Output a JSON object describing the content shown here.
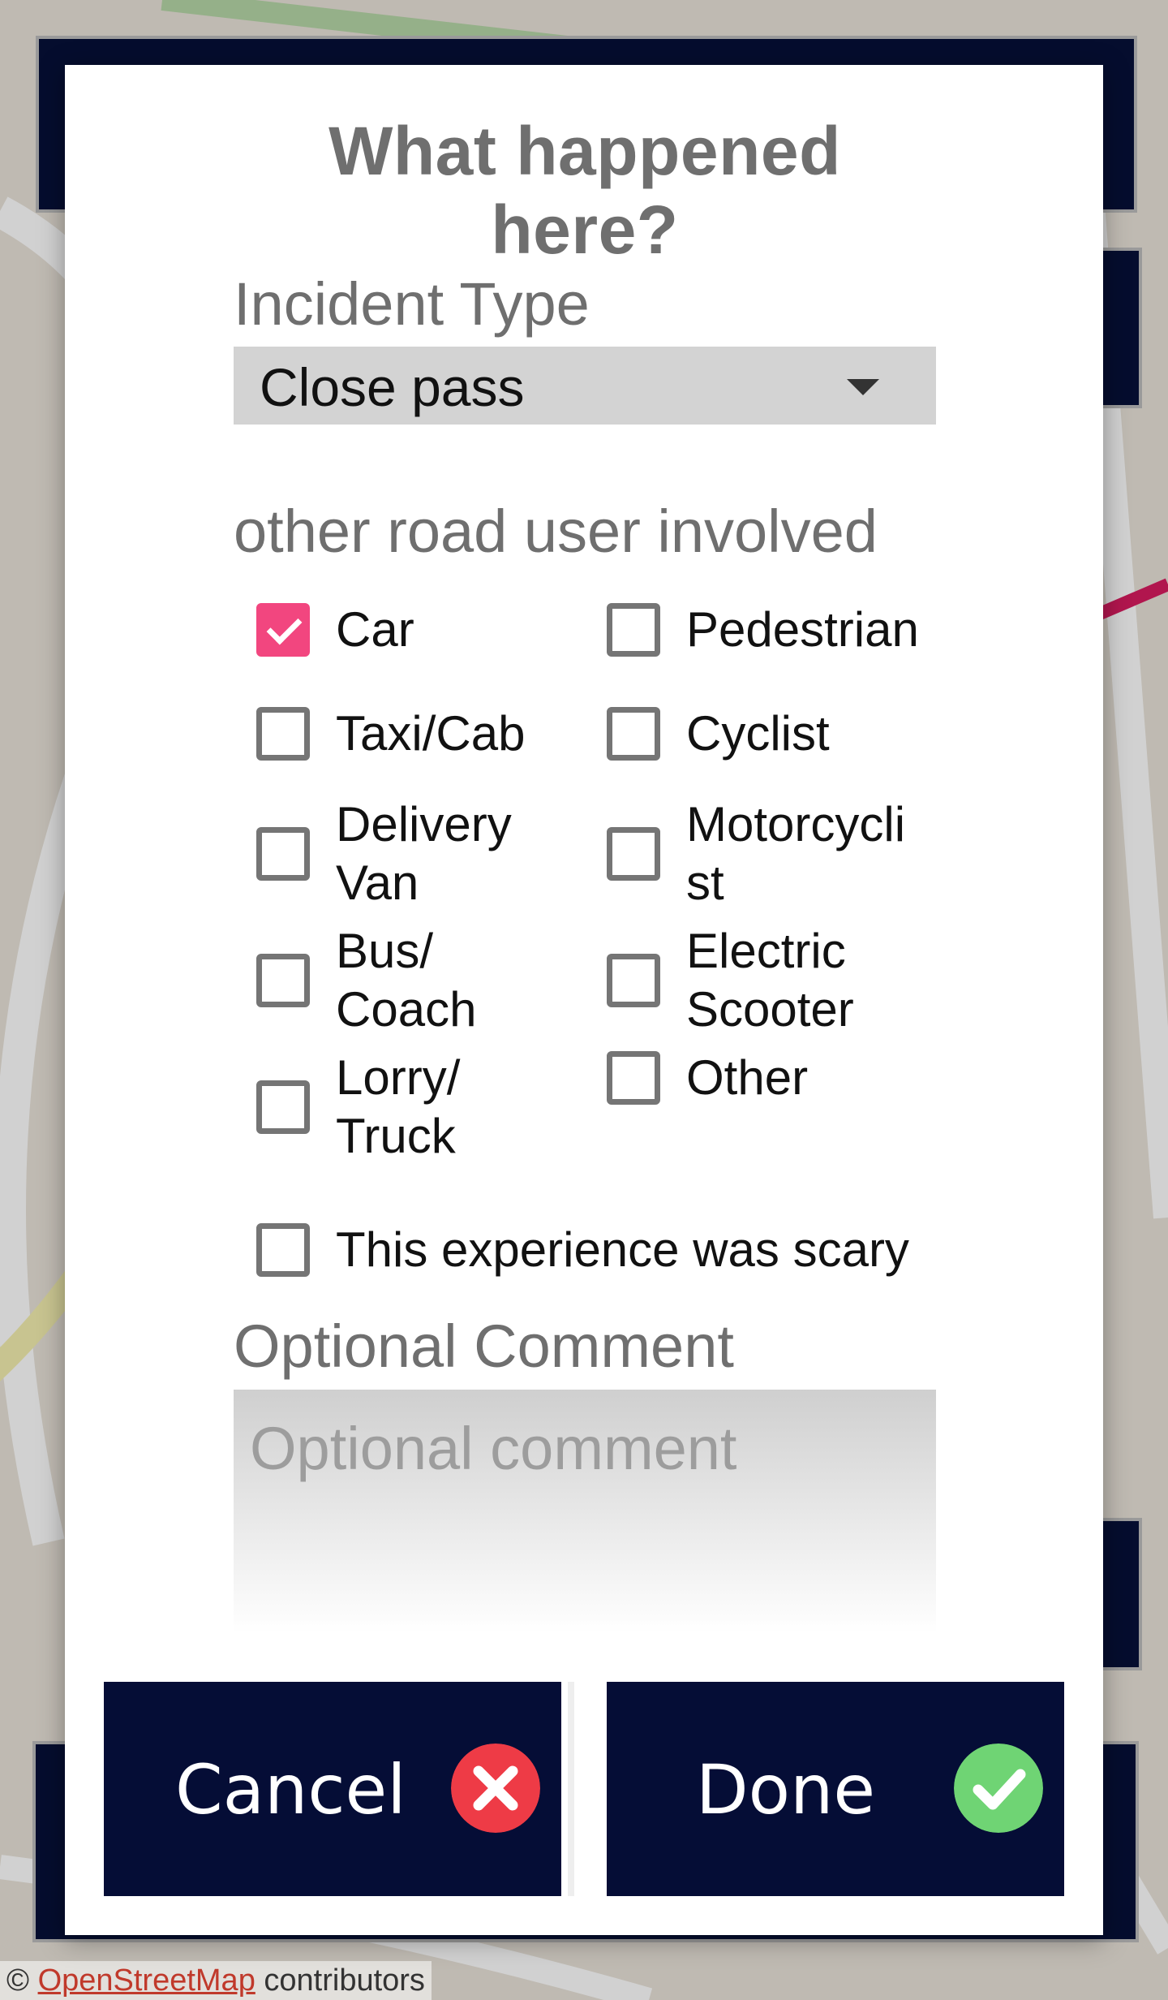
{
  "map": {
    "attribution_prefix": "©",
    "attribution_link": "OpenStreetMap",
    "attribution_suffix": "contributors"
  },
  "dialog": {
    "title": "What happened here?",
    "incident_type": {
      "label": "Incident Type",
      "selected": "Close pass"
    },
    "road_users": {
      "label": "other road user involved",
      "options": [
        {
          "label": "Car",
          "checked": true
        },
        {
          "label": "Pedestrian",
          "checked": false
        },
        {
          "label": "Taxi/Cab",
          "checked": false
        },
        {
          "label": "Cyclist",
          "checked": false
        },
        {
          "label": "Delivery\nVan",
          "checked": false
        },
        {
          "label": "Motorcycli\nst",
          "checked": false
        },
        {
          "label": "Bus/\nCoach",
          "checked": false
        },
        {
          "label": "Electric\nScooter",
          "checked": false
        },
        {
          "label": "Lorry/\nTruck",
          "checked": false
        },
        {
          "label": "Other",
          "checked": false
        }
      ]
    },
    "scary": {
      "label": "This experience was scary",
      "checked": false
    },
    "comment": {
      "label": "Optional Comment",
      "placeholder": "Optional comment"
    },
    "buttons": {
      "cancel": "Cancel",
      "done": "Done"
    }
  },
  "colors": {
    "checkbox_checked": "#f2467f",
    "button_bg": "#050d36",
    "cancel_icon": "#ee3b46",
    "done_icon": "#6fd474"
  }
}
